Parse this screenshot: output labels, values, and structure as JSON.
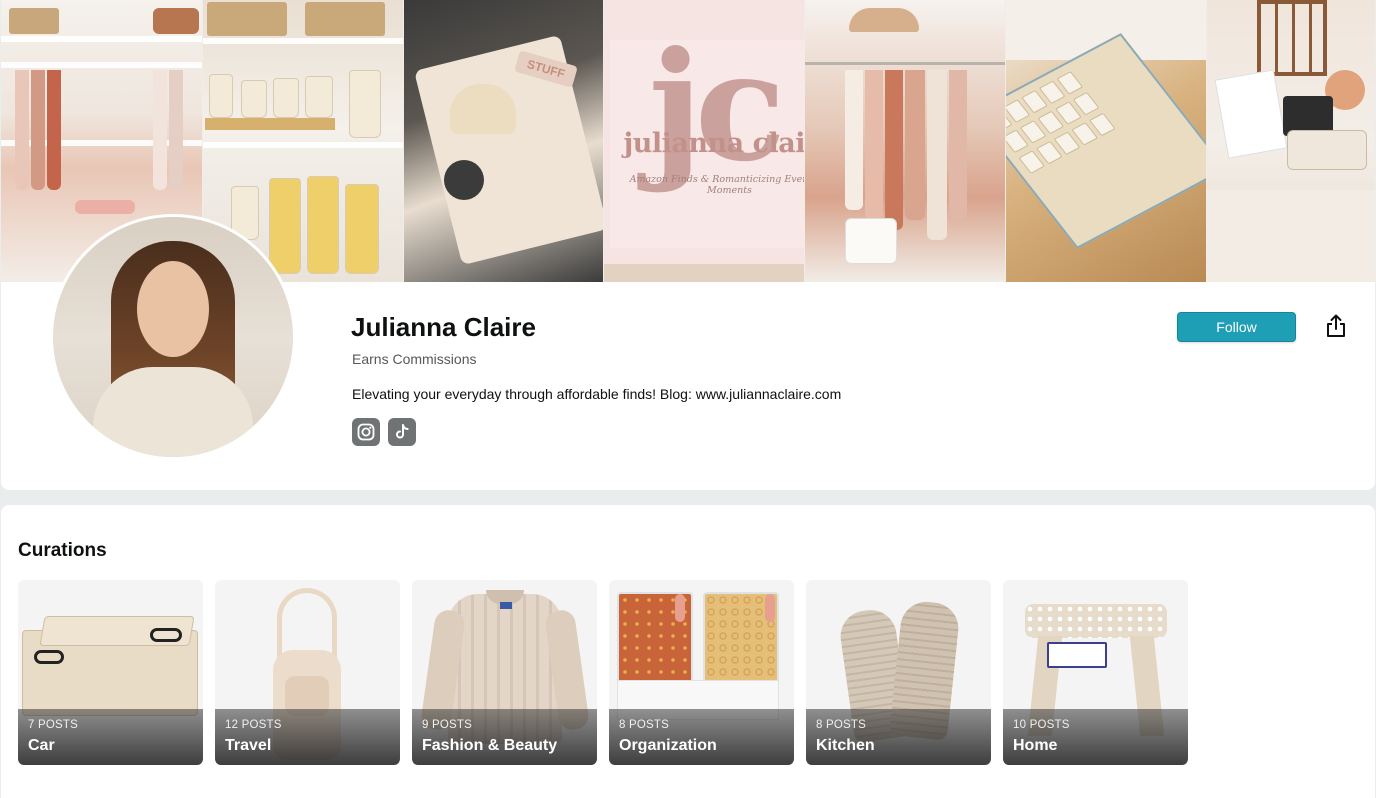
{
  "profile": {
    "name": "Julianna Claire",
    "earns": "Earns Commissions",
    "bio": "Elevating your everyday through affordable finds! Blog: www.juliannaclaire.com",
    "follow_label": "Follow",
    "accent_color": "#1f9fb5"
  },
  "banner": {
    "logo_mark": "jc",
    "logo_name": "julianna claire",
    "logo_tagline": "Amazon Finds & Romanticizing Everyday Moments",
    "packing_cube_label": "STUFF"
  },
  "socials": [
    {
      "icon": "instagram-icon"
    },
    {
      "icon": "tiktok-icon"
    }
  ],
  "curations": {
    "title": "Curations",
    "items": [
      {
        "count": "7 POSTS",
        "name": "Car"
      },
      {
        "count": "12 POSTS",
        "name": "Travel"
      },
      {
        "count": "9 POSTS",
        "name": "Fashion & Beauty"
      },
      {
        "count": "8 POSTS",
        "name": "Organization"
      },
      {
        "count": "8 POSTS",
        "name": "Kitchen"
      },
      {
        "count": "10 POSTS",
        "name": "Home"
      }
    ]
  }
}
